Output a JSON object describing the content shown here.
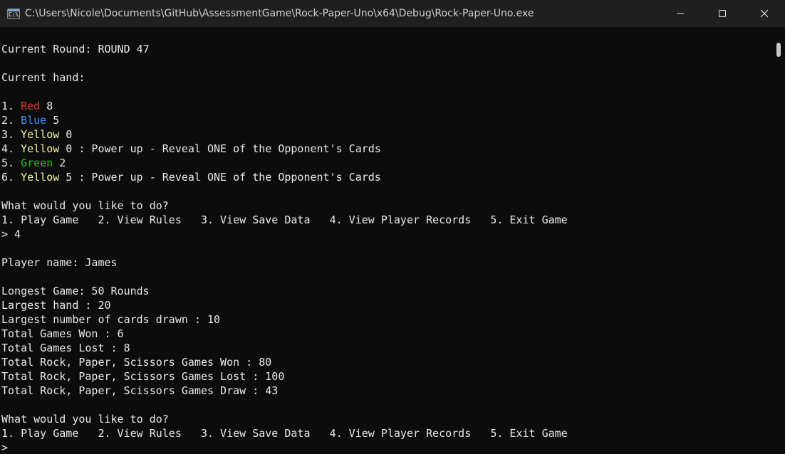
{
  "window": {
    "title": "C:\\Users\\Nicole\\Documents\\GitHub\\AssessmentGame\\Rock-Paper-Uno\\x64\\Debug\\Rock-Paper-Uno.exe",
    "icon_text": "C:\\"
  },
  "console": {
    "round_line": "Current Round: ROUND 47",
    "hand_label": "Current hand:",
    "hand": [
      {
        "num": "1. ",
        "color": "Red",
        "rest": " 8"
      },
      {
        "num": "2. ",
        "color": "Blue",
        "rest": " 5"
      },
      {
        "num": "3. ",
        "color": "Yellow",
        "rest": " 0"
      },
      {
        "num": "4. ",
        "color": "Yellow",
        "rest": " 0 : Power up - Reveal ONE of the Opponent's Cards"
      },
      {
        "num": "5. ",
        "color": "Green",
        "rest": " 2"
      },
      {
        "num": "6. ",
        "color": "Yellow",
        "rest": " 5 : Power up - Reveal ONE of the Opponent's Cards"
      }
    ],
    "prompt_question": "What would you like to do?",
    "menu": "1. Play Game   2. View Rules   3. View Save Data   4. View Player Records   5. Exit Game",
    "input_1": "> 4",
    "player_name": "Player name: James",
    "stats": [
      "Longest Game: 50 Rounds",
      "Largest hand : 20",
      "Largest number of cards drawn : 10",
      "Total Games Won : 6",
      "Total Games Lost : 8",
      "Total Rock, Paper, Scissors Games Won : 80",
      "Total Rock, Paper, Scissors Games Lost : 100",
      "Total Rock, Paper, Scissors Games Draw : 43"
    ],
    "prompt_question_2": "What would you like to do?",
    "menu_2": "1. Play Game   2. View Rules   3. View Save Data   4. View Player Records   5. Exit Game",
    "input_2": ">"
  },
  "colors": {
    "background": "#0c0c0c",
    "text": "#e8e8e8",
    "red": "#d83b3b",
    "blue": "#3b8eea",
    "yellow": "#f2f2a0",
    "green": "#16c60c"
  },
  "icons": [
    "console-app-icon",
    "minimize-icon",
    "maximize-icon",
    "close-icon"
  ]
}
